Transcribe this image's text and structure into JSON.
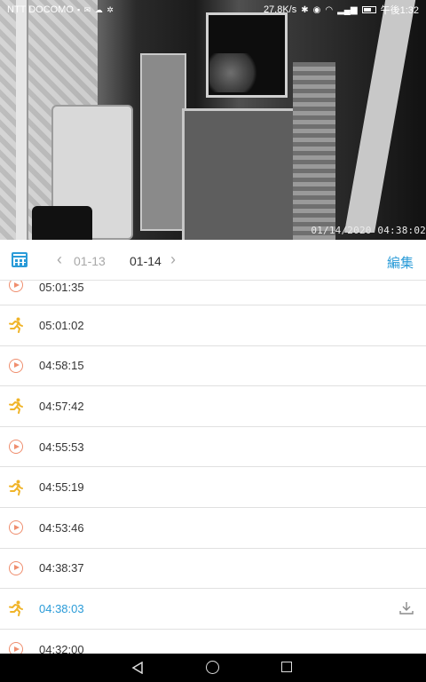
{
  "status_bar": {
    "carrier": "NTT DOCOMO",
    "net_speed": "27.8K/s",
    "time": "午後1:32"
  },
  "video": {
    "timestamp": "01/14/2020 04:38:02"
  },
  "toolbar": {
    "prev_date": "01-13",
    "current_date": "01-14",
    "edit_label": "編集"
  },
  "events": [
    {
      "time": "05:01:35",
      "type": "video"
    },
    {
      "time": "05:01:02",
      "type": "motion"
    },
    {
      "time": "04:58:15",
      "type": "video"
    },
    {
      "time": "04:57:42",
      "type": "motion"
    },
    {
      "time": "04:55:53",
      "type": "video"
    },
    {
      "time": "04:55:19",
      "type": "motion"
    },
    {
      "time": "04:53:46",
      "type": "video"
    },
    {
      "time": "04:38:37",
      "type": "video"
    },
    {
      "time": "04:38:03",
      "type": "motion",
      "active": true
    },
    {
      "time": "04:32:00",
      "type": "video"
    }
  ],
  "colors": {
    "accent": "#2a9bd8",
    "play_icon": "#ef8e6e",
    "motion_icon": "#f0b429"
  }
}
